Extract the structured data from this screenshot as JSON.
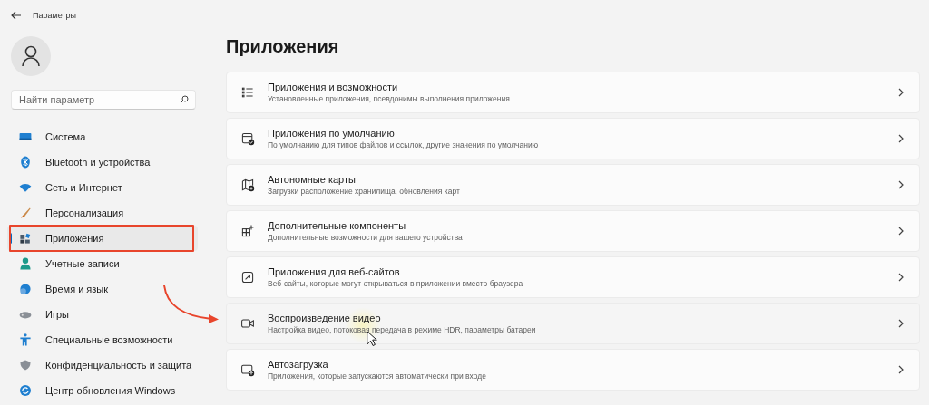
{
  "window": {
    "title": "Параметры"
  },
  "search": {
    "placeholder": "Найти параметр"
  },
  "nav": [
    {
      "label": "Система",
      "selected": false,
      "annotated": false
    },
    {
      "label": "Bluetooth и устройства",
      "selected": false,
      "annotated": false
    },
    {
      "label": "Сеть и Интернет",
      "selected": false,
      "annotated": false
    },
    {
      "label": "Персонализация",
      "selected": false,
      "annotated": false
    },
    {
      "label": "Приложения",
      "selected": true,
      "annotated": true
    },
    {
      "label": "Учетные записи",
      "selected": false,
      "annotated": false
    },
    {
      "label": "Время и язык",
      "selected": false,
      "annotated": false
    },
    {
      "label": "Игры",
      "selected": false,
      "annotated": false
    },
    {
      "label": "Специальные возможности",
      "selected": false,
      "annotated": false
    },
    {
      "label": "Конфиденциальность и защита",
      "selected": false,
      "annotated": false
    },
    {
      "label": "Центр обновления Windows",
      "selected": false,
      "annotated": false
    }
  ],
  "page_title": "Приложения",
  "cards": [
    {
      "title": "Приложения и возможности",
      "subtitle": "Установленные приложения, псевдонимы выполнения приложения",
      "hovered": false,
      "pointed": false
    },
    {
      "title": "Приложения по умолчанию",
      "subtitle": "По умолчанию для типов файлов и ссылок, другие значения по умолчанию",
      "hovered": false,
      "pointed": false
    },
    {
      "title": "Автономные карты",
      "subtitle": "Загрузки расположение хранилища, обновления карт",
      "hovered": false,
      "pointed": false
    },
    {
      "title": "Дополнительные компоненты",
      "subtitle": "Дополнительные возможности для вашего устройства",
      "hovered": false,
      "pointed": false
    },
    {
      "title": "Приложения для веб-сайтов",
      "subtitle": "Веб-сайты, которые могут открываться в приложении вместо браузера",
      "hovered": false,
      "pointed": false
    },
    {
      "title": "Воспроизведение видео",
      "subtitle": "Настройка видео, потоковая передача в режиме HDR, параметры батареи",
      "hovered": true,
      "pointed": true
    },
    {
      "title": "Автозагрузка",
      "subtitle": "Приложения, которые запускаются автоматически при входе",
      "hovered": false,
      "pointed": false
    }
  ]
}
